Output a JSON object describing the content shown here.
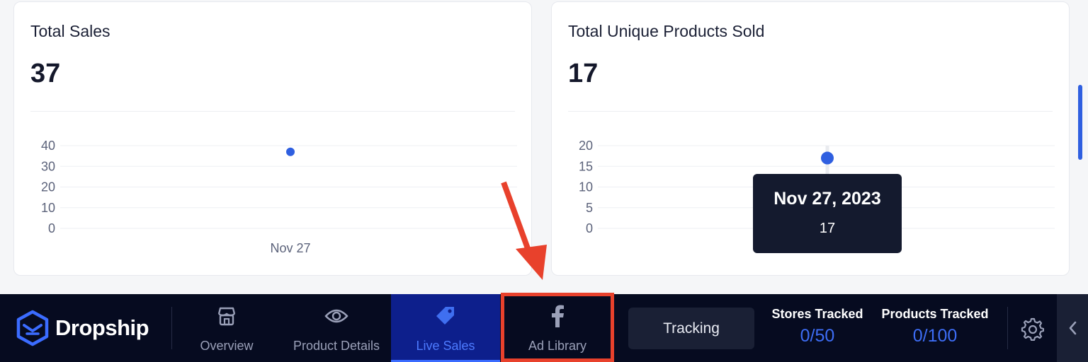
{
  "cards": [
    {
      "title": "Total Sales",
      "value": "37"
    },
    {
      "title": "Total Unique Products Sold",
      "value": "17"
    }
  ],
  "chart_data": [
    {
      "type": "scatter",
      "title": "Total Sales",
      "x": [
        "Nov 27"
      ],
      "values": [
        37
      ],
      "yticks": [
        0,
        10,
        20,
        30,
        40
      ],
      "ylim": [
        0,
        40
      ],
      "xticks": [
        "Nov 27"
      ],
      "grid": true,
      "color": "#2f5fe0"
    },
    {
      "type": "scatter",
      "title": "Total Unique Products Sold",
      "x": [
        "Nov 27, 2023"
      ],
      "values": [
        17
      ],
      "yticks": [
        0,
        5,
        10,
        15,
        20
      ],
      "ylim": [
        0,
        20
      ],
      "grid": true,
      "color": "#2f5fe0",
      "tooltip": {
        "date": "Nov 27, 2023",
        "value": "17"
      }
    }
  ],
  "footer": {
    "brand": "Dropship",
    "nav": [
      {
        "label": "Overview",
        "icon": "store-icon",
        "active": false
      },
      {
        "label": "Product Details",
        "icon": "eye-icon",
        "active": false
      },
      {
        "label": "Live Sales",
        "icon": "tag-icon",
        "active": true
      },
      {
        "label": "Ad Library",
        "icon": "facebook-icon",
        "active": false,
        "highlighted": true
      }
    ],
    "tracking_label": "Tracking",
    "stores_tracked": {
      "label": "Stores Tracked",
      "value": "0/50"
    },
    "products_tracked": {
      "label": "Products Tracked",
      "value": "0/100"
    }
  },
  "colors": {
    "accent": "#2f5fe0",
    "footer_bg": "#060b20",
    "active_nav_bg": "#0d1f8c",
    "highlight_box": "#e8412c",
    "arrow": "#e8412c"
  }
}
